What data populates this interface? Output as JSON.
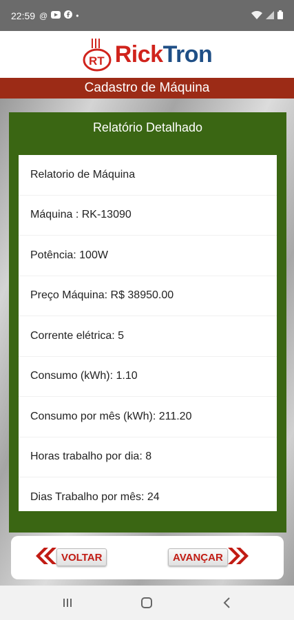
{
  "status_bar": {
    "time": "22:59",
    "left_icons": [
      "at-icon",
      "youtube-icon",
      "facebook-icon",
      "dot-icon"
    ],
    "right_icons": [
      "wifi-icon",
      "signal-icon",
      "battery-icon"
    ]
  },
  "logo": {
    "part1": "Rick",
    "part2": "Tron",
    "mark_text": "RT"
  },
  "title_bar": {
    "title": "Cadastro de Máquina"
  },
  "report": {
    "title": "Relatório Detalhado",
    "rows": [
      "Relatorio de Máquina",
      "Máquina : RK-13090",
      "Potência: 100W",
      "Preço Máquina:  R$ 38950.00",
      "Corrente elétrica: 5",
      "Consumo (kWh): 1.10",
      "Consumo por mês (kWh): 211.20",
      "Horas trabalho por dia:  8",
      "Dias Trabalho por mês: 24"
    ]
  },
  "buttons": {
    "back_label": "VOLTAR",
    "next_label": "AVANÇAR"
  },
  "nav": {
    "icons": [
      "recent-apps-icon",
      "home-icon",
      "back-icon"
    ]
  },
  "colors": {
    "brand_red": "#c11c14",
    "brand_blue": "#1f4f86",
    "title_bar": "#9c2b16",
    "panel_green": "#3a6613"
  }
}
